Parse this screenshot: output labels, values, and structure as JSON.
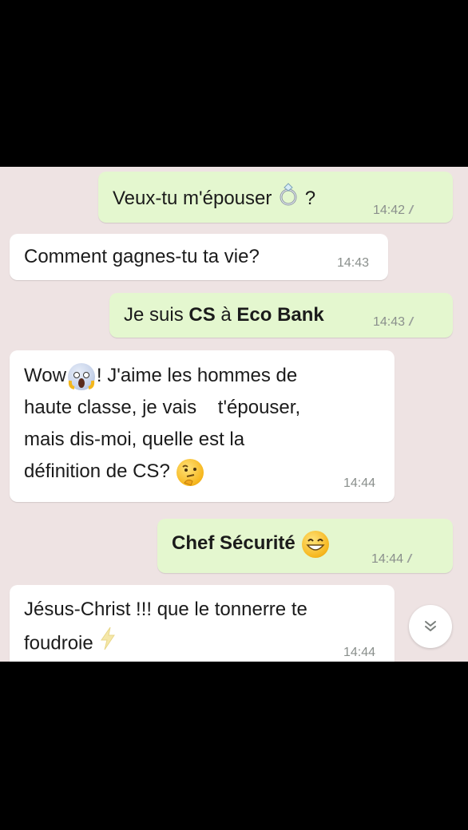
{
  "messages": [
    {
      "direction": "out",
      "text": "Veux-tu m'épouser",
      "suffix": "?",
      "emoji": "ring-icon",
      "time": "14:42",
      "ticks": "//"
    },
    {
      "direction": "in",
      "text": "Comment gagnes-tu ta vie?",
      "time": "14:43"
    },
    {
      "direction": "out",
      "parts": [
        "Je suis ",
        "CS",
        " à ",
        "Eco Bank"
      ],
      "time": "14:43",
      "ticks": "//"
    },
    {
      "direction": "in",
      "lines": [
        "Wow",
        "! J'aime les hommes de",
        "haute classe, je vais    t'épouser,",
        "mais dis-moi, quelle est la",
        "définition de CS?"
      ],
      "emojis": [
        "screaming-face-icon",
        "thinking-face-icon"
      ],
      "time": "14:44"
    },
    {
      "direction": "out",
      "text": "Chef Sécurité",
      "emoji": "grinning-face-icon",
      "time": "14:44",
      "ticks": "//"
    },
    {
      "direction": "in",
      "lines": [
        "Jésus-Christ !!!  que le tonnerre te",
        "foudroie"
      ],
      "emoji": "lightning-icon",
      "time": "14:44"
    }
  ],
  "scroll_button": {
    "icon": "double-chevron-down-icon"
  },
  "colors": {
    "outgoing_bubble": "#e4f7cf",
    "incoming_bubble": "#ffffff",
    "chat_background": "#eee3e3"
  }
}
